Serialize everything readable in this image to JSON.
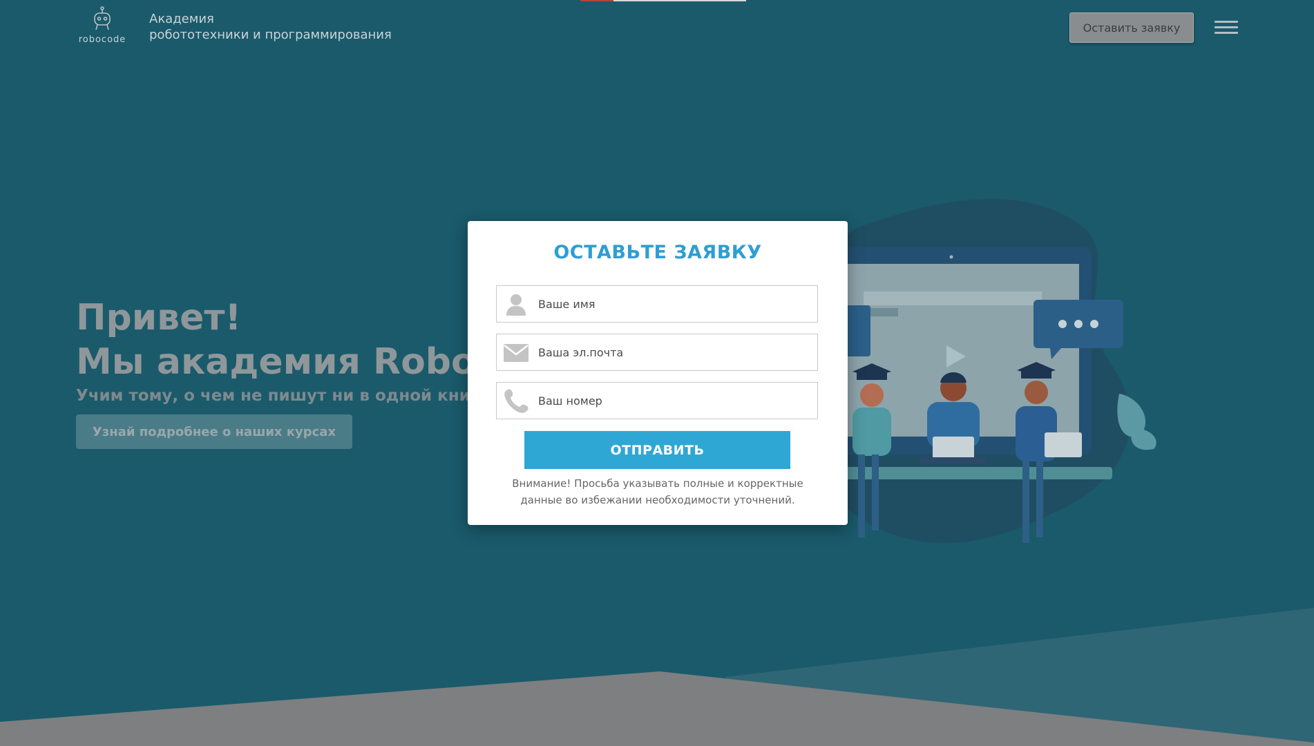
{
  "header": {
    "logo_text": "robocode",
    "tagline_line1": "Академия",
    "tagline_line2": "робототехники и программирования",
    "cta_label": "Оставить заявку"
  },
  "hero": {
    "title_line1": "Привет!",
    "title_line2": "Мы академия RoboCode",
    "subtitle": "Учим тому, о чем не пишут ни в одной книге",
    "button_label": "Узнай подробнее о наших курсах"
  },
  "modal": {
    "title": "ОСТАВЬТЕ ЗАЯВКУ",
    "name_placeholder": "Ваше имя",
    "email_placeholder": "Ваша эл.почта",
    "phone_placeholder": "Ваш номер",
    "submit_label": "ОТПРАВИТЬ",
    "notice_line1": "Внимание! Просьба указывать полные и корректные",
    "notice_line2": "данные во избежании необходимости уточнений."
  },
  "icons": {
    "name": "user-icon",
    "email": "envelope-icon",
    "phone": "phone-icon",
    "menu": "hamburger-menu-icon"
  },
  "colors": {
    "background": "#1a5a6b",
    "accent": "#2fa7d4",
    "modal_bg": "#ffffff"
  }
}
